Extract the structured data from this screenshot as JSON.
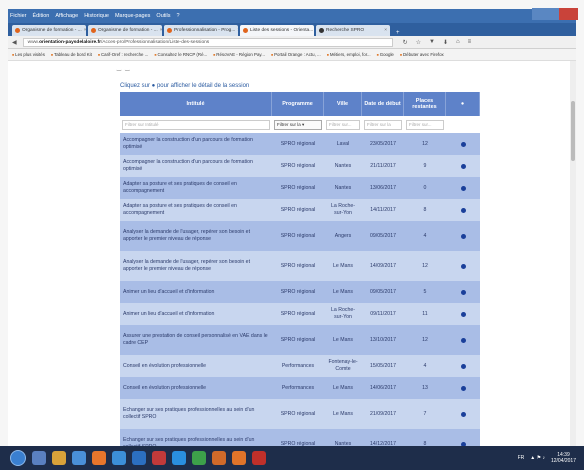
{
  "menubar": {
    "items": [
      "Fichier",
      "Édition",
      "Affichage",
      "Historique",
      "Marque-pages",
      "Outils",
      "?"
    ]
  },
  "tabs": [
    {
      "label": "Organisme de formation - ..."
    },
    {
      "label": "Organisme de formation - ..."
    },
    {
      "label": "Professionnalisation - Prog..."
    },
    {
      "label": "Liste des sessions - Orienta..."
    },
    {
      "label": "Recherche SPRO"
    }
  ],
  "tab_new": "+",
  "url": {
    "prefix": "www.",
    "domain": "orientation-paysdelaloire.fr",
    "path": "/Acces-pro/Professionnalisation/Liste-des-sessions"
  },
  "bookmarks": [
    "Les plus visités",
    "Tableau de bord Kit",
    "Carif-Oref : recherche ...",
    "Consultez le RNCP (Ré...",
    "RésoVAE - Région Pay...",
    "Portail Orange : Actu, ...",
    "Métiers, emploi, for...",
    "Google",
    "Débuter avec Firefox"
  ],
  "hint": "Cliquez sur ● pour afficher le détail de la session",
  "table": {
    "headers": [
      "Intitulé",
      "Programme",
      "Ville",
      "Date de début",
      "Places restantes",
      "●"
    ],
    "filters": {
      "intitule": "Filtrer sur Intitulé",
      "programme": "Filtrer sur la ▾",
      "ville": "Filtrer sur...",
      "date": "Filtrer sur la",
      "places": "Filtrer sur..."
    },
    "rows": [
      {
        "intitule": "Accompagner la construction d'un parcours de formation optimisé",
        "programme": "SPRO régional",
        "ville": "Laval",
        "date": "23/05/2017",
        "places": "12"
      },
      {
        "intitule": "Accompagner la construction d'un parcours de formation optimisé",
        "programme": "SPRO régional",
        "ville": "Nantes",
        "date": "21/11/2017",
        "places": "9"
      },
      {
        "intitule": "Adapter sa posture et ses pratiques de conseil en accompagnement",
        "programme": "SPRO régional",
        "ville": "Nantes",
        "date": "13/06/2017",
        "places": "0"
      },
      {
        "intitule": "Adapter sa posture et ses pratiques de conseil en accompagnement",
        "programme": "SPRO régional",
        "ville": "La Roche-sur-Yon",
        "date": "14/11/2017",
        "places": "8"
      },
      {
        "intitule": "Analyser la demande de l'usager, repérer son besoin et apporter le premier niveau de réponse",
        "programme": "SPRO régional",
        "ville": "Angers",
        "date": "09/05/2017",
        "places": "4"
      },
      {
        "intitule": "Analyser la demande de l'usager, repérer son besoin et apporter le premier niveau de réponse",
        "programme": "SPRO régional",
        "ville": "Le Mans",
        "date": "14/09/2017",
        "places": "12"
      },
      {
        "intitule": "Animer un lieu d'accueil et d'information",
        "programme": "SPRO régional",
        "ville": "Le Mans",
        "date": "09/05/2017",
        "places": "5"
      },
      {
        "intitule": "Animer un lieu d'accueil et d'information",
        "programme": "SPRO régional",
        "ville": "La Roche-sur-Yon",
        "date": "09/11/2017",
        "places": "11"
      },
      {
        "intitule": "Assurer une prestation de conseil personnalisé en VAE dans le cadre CEP",
        "programme": "SPRO régional",
        "ville": "Le Mans",
        "date": "13/10/2017",
        "places": "12"
      },
      {
        "intitule": "Conseil en évolution professionnelle",
        "programme": "Performances",
        "ville": "Fontenay-le-Comte",
        "date": "15/05/2017",
        "places": "4"
      },
      {
        "intitule": "Conseil en évolution professionnelle",
        "programme": "Performances",
        "ville": "Le Mans",
        "date": "14/06/2017",
        "places": "13"
      },
      {
        "intitule": "Echanger sur ses pratiques professionnelles au sein d'un collectif SPRO",
        "programme": "SPRO régional",
        "ville": "Le Mans",
        "date": "21/09/2017",
        "places": "7"
      },
      {
        "intitule": "Echanger sur ses pratiques professionnelles au sein d'un collectif SPRO",
        "programme": "SPRO régional",
        "ville": "Nantes",
        "date": "14/12/2017",
        "places": "8"
      }
    ]
  },
  "tray": {
    "lang": "FR",
    "time": "14:39",
    "date": "12/04/2017"
  }
}
